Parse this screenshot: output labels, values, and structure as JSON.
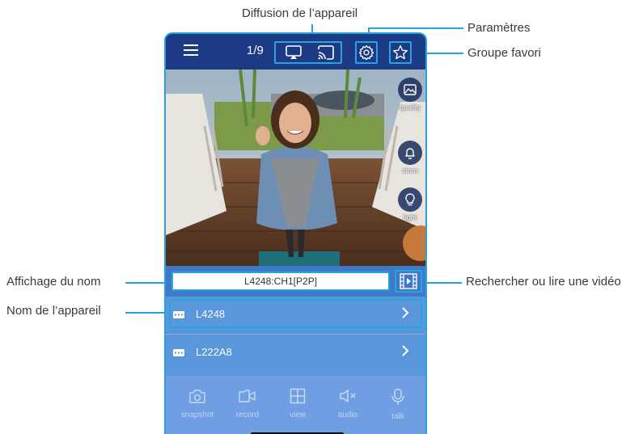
{
  "callouts": {
    "diffusion": "Diffusion de l’appareil",
    "parametres": "Paramètres",
    "groupe_favori": "Groupe favori",
    "affichage_nom": "Affichage du nom",
    "nom_appareil": "Nom de l’appareil",
    "rechercher": "Rechercher ou lire une vidéo"
  },
  "app": {
    "page_indicator": "1/9",
    "icons": {
      "menu": "hamburger-menu-icon",
      "airplay": "airplay-icon",
      "cast": "cast-icon",
      "settings": "gear-icon",
      "favorite": "star-icon"
    },
    "side_controls": [
      {
        "label": "quality",
        "icon": "image-icon"
      },
      {
        "label": "siren",
        "icon": "bell-icon"
      },
      {
        "label": "light",
        "icon": "bulb-icon"
      }
    ],
    "channel_name": "L4248:CH1[P2P]",
    "devices": [
      {
        "name": "L4248",
        "selected": true
      },
      {
        "name": "L222A8",
        "selected": false
      }
    ],
    "toolbar": [
      {
        "label": "snapshot",
        "icon": "camera-icon"
      },
      {
        "label": "record",
        "icon": "video-record-icon"
      },
      {
        "label": "view",
        "icon": "grid-icon"
      },
      {
        "label": "audio",
        "icon": "speaker-mute-icon"
      },
      {
        "label": "talk",
        "icon": "microphone-icon"
      }
    ],
    "colors": {
      "accent": "#27a3e0",
      "topbar": "#1d3a85",
      "list": "#5a96da",
      "toolbar": "#6f9fe2"
    }
  }
}
